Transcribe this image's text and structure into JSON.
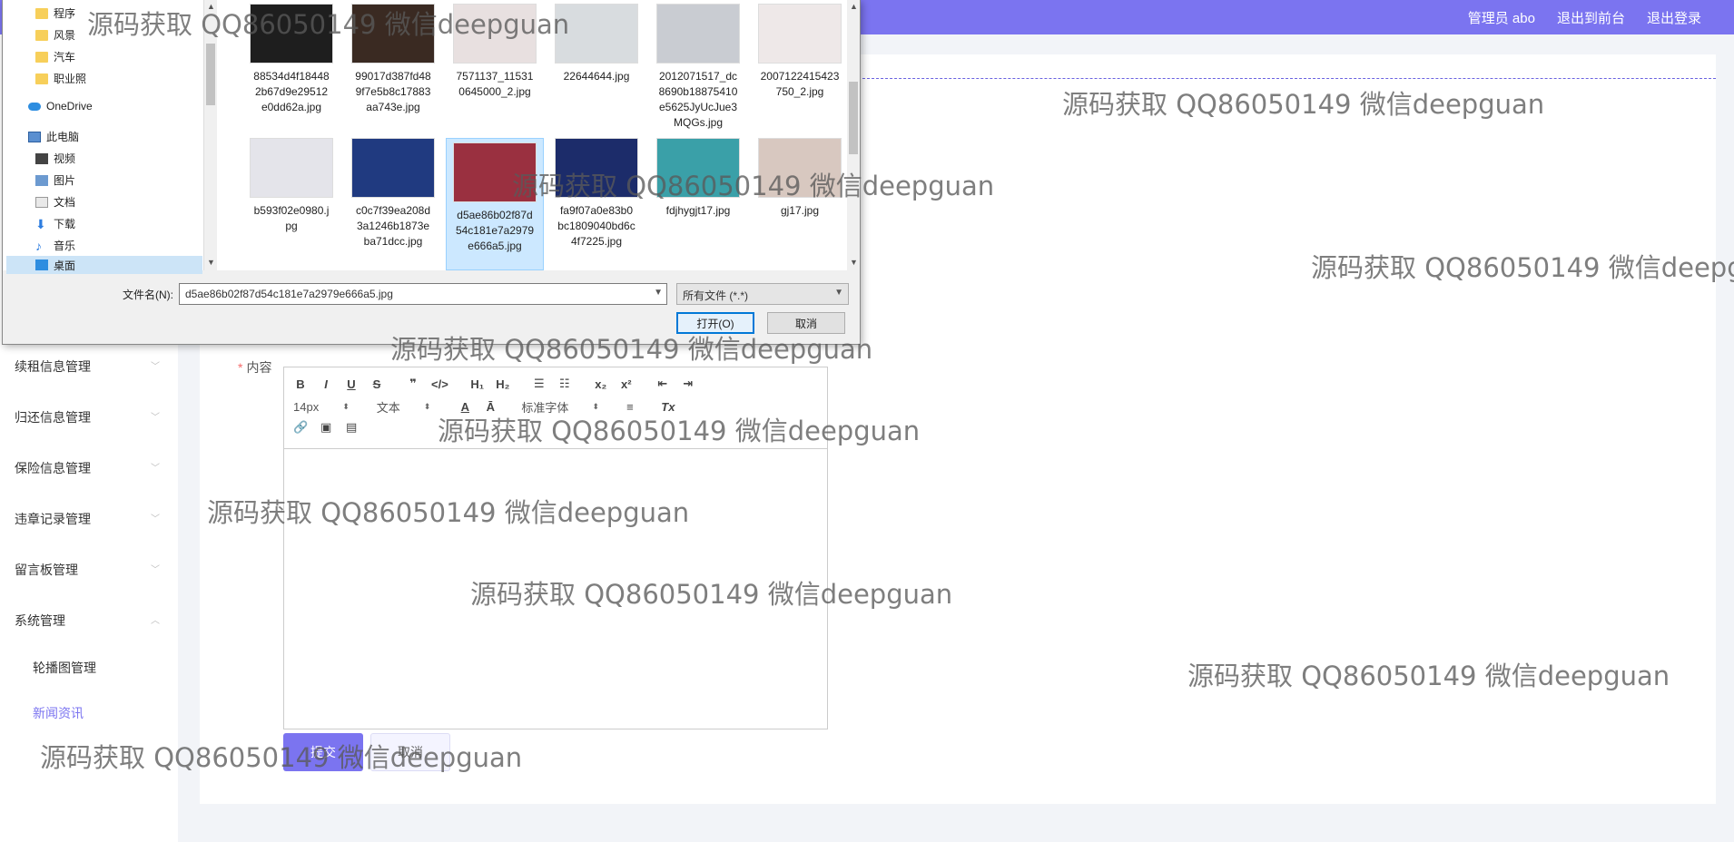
{
  "header": {
    "admin_label": "管理员 abo",
    "front_link": "退出到前台",
    "logout_link": "退出登录"
  },
  "sidebar": {
    "menus": [
      {
        "label": "续租信息管理"
      },
      {
        "label": "归还信息管理"
      },
      {
        "label": "保险信息管理"
      },
      {
        "label": "违章记录管理"
      },
      {
        "label": "留言板管理"
      },
      {
        "label": "系统管理"
      }
    ],
    "submenus": [
      {
        "label": "轮播图管理"
      },
      {
        "label": "新闻资讯"
      }
    ]
  },
  "form": {
    "content_label": "内容",
    "submit_label": "提交",
    "cancel_label": "取消",
    "toolbar": {
      "bold": "B",
      "italic": "I",
      "underline": "U",
      "strike": "S",
      "quote": "❞",
      "code": "</>",
      "h1": "H₁",
      "h2": "H₂",
      "ordered": "☰",
      "bullet": "☷",
      "sub": "x₂",
      "sup": "x²",
      "outdent": "⇤",
      "indent": "⇥",
      "size_value": "14px",
      "header_value": "文本",
      "font_value": "标准字体",
      "color": "A",
      "bg": "Ā",
      "align": "≡",
      "clean": "Tx",
      "link": "🔗",
      "image": "▣",
      "video": "▤"
    }
  },
  "dialog": {
    "nav": [
      {
        "label": "程序",
        "icon": "folder-icon"
      },
      {
        "label": "风景",
        "icon": "folder-icon"
      },
      {
        "label": "汽车",
        "icon": "folder-icon"
      },
      {
        "label": "职业照",
        "icon": "folder-icon"
      },
      {
        "label": "OneDrive",
        "icon": "cloud-icon"
      },
      {
        "label": "此电脑",
        "icon": "computer-icon"
      },
      {
        "label": "视频",
        "icon": "video-icon"
      },
      {
        "label": "图片",
        "icon": "picture-icon"
      },
      {
        "label": "文档",
        "icon": "document-icon"
      },
      {
        "label": "下载",
        "icon": "download-icon"
      },
      {
        "label": "音乐",
        "icon": "music-icon"
      },
      {
        "label": "桌面",
        "icon": "desktop-icon"
      }
    ],
    "files": [
      {
        "name": "88534d4f184482b67d9e29512e0dd62a.jpg",
        "lines": [
          "88534d4f18448",
          "2b67d9e29512",
          "e0dd62a.jpg"
        ],
        "color": "#1e1e1e"
      },
      {
        "name": "99017d387fd489f7e5b8c17883aa743e.jpg",
        "lines": [
          "99017d387fd48",
          "9f7e5b8c17883",
          "aa743e.jpg"
        ],
        "color": "#3a2a22"
      },
      {
        "name": "7571137_115310645000_2.jpg",
        "lines": [
          "7571137_11531",
          "0645000_2.jpg"
        ],
        "color": "#e8e0e0"
      },
      {
        "name": "22644644.jpg",
        "lines": [
          "22644644.jpg"
        ],
        "color": "#d8dcdf"
      },
      {
        "name": "2012071517_dc8690b18875410e5625JyUcJue3MQGs.jpg",
        "lines": [
          "2012071517_dc",
          "8690b18875410",
          "e5625JyUcJue3",
          "MQGs.jpg"
        ],
        "color": "#c9ccd2"
      },
      {
        "name": "2007122415423750_2.jpg",
        "lines": [
          "2007122415423",
          "750_2.jpg"
        ],
        "color": "#eee8e8"
      },
      {
        "name": "b593f02e0980.jpg",
        "lines": [
          "b593f02e0980.j",
          "pg"
        ],
        "color": "#e4e4ea"
      },
      {
        "name": "c0c7f39ea208d3a1246b1873eba71dcc.jpg",
        "lines": [
          "c0c7f39ea208d",
          "3a1246b1873e",
          "ba71dcc.jpg"
        ],
        "color": "#203a80"
      },
      {
        "name": "d5ae86b02f87d54c181e7a2979e666a5.jpg",
        "lines": [
          "d5ae86b02f87d",
          "54c181e7a2979",
          "e666a5.jpg"
        ],
        "color": "#9a3040"
      },
      {
        "name": "fa9f07a0e83b0bc1809040bd6c4f7225.jpg",
        "lines": [
          "fa9f07a0e83b0",
          "bc1809040bd6c",
          "4f7225.jpg"
        ],
        "color": "#1c2c6a"
      },
      {
        "name": "fdjhygjt17.jpg",
        "lines": [
          "fdjhygjt17.jpg"
        ],
        "color": "#3aa0a8"
      },
      {
        "name": "gj17.jpg",
        "lines": [
          "gj17.jpg"
        ],
        "color": "#d8c8c0"
      }
    ],
    "filename_label": "文件名(N):",
    "filename_value": "d5ae86b02f87d54c181e7a2979e666a5.jpg",
    "filetype_value": "所有文件 (*.*)",
    "open_label": "打开(O)",
    "cancel_label": "取消"
  },
  "watermark": "源码获取 QQ86050149 微信deepguan"
}
